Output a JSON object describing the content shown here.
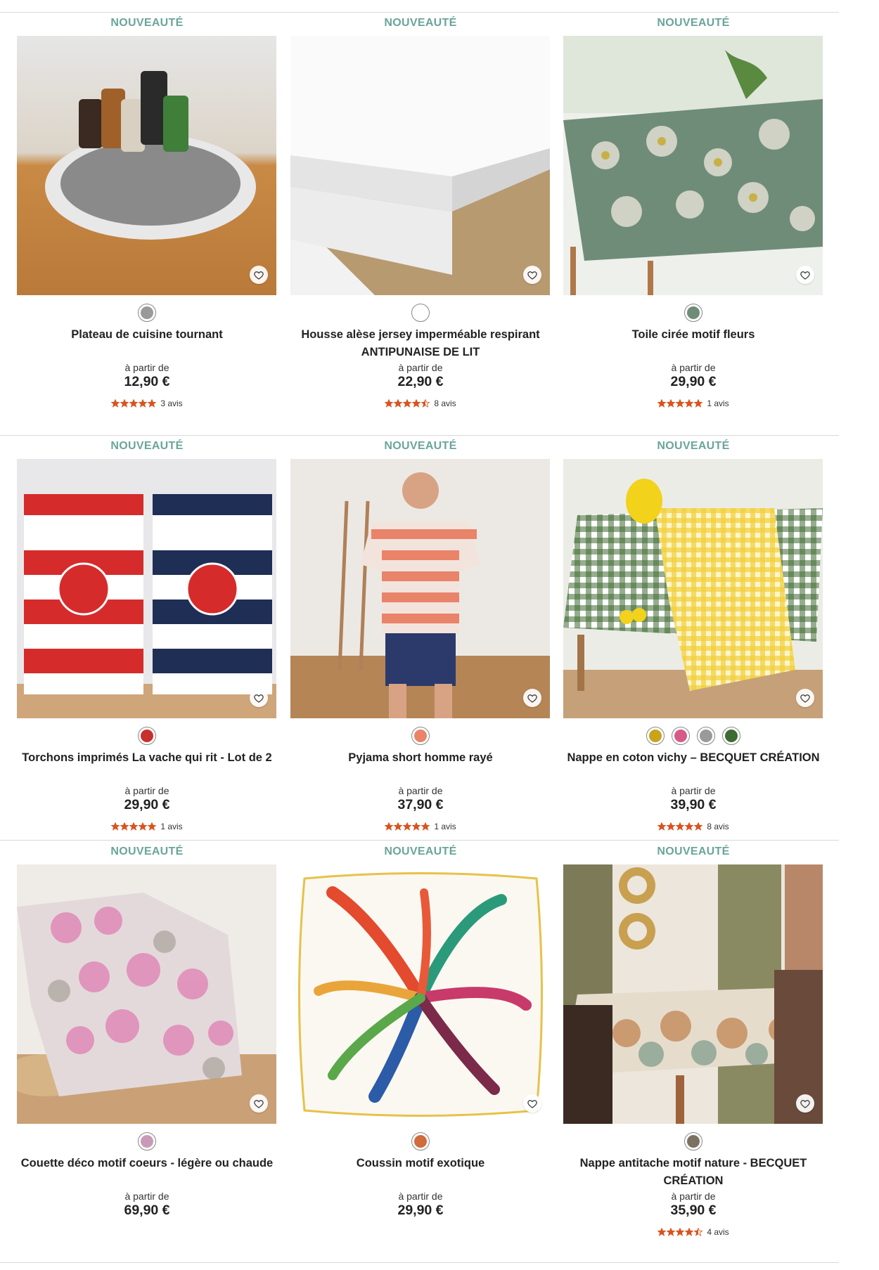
{
  "badge_label": "NOUVEAUTÉ",
  "from_label": "à partir de",
  "colors": {
    "badge": "#6aa59a",
    "star": "#d9531e"
  },
  "products": [
    {
      "badge": "NOUVEAUTÉ",
      "image": "rotating-kitchen-tray-photo",
      "title": "Plateau de cuisine tournant",
      "from": "à partir de",
      "price": "12,90 €",
      "rating": 5,
      "reviews": "3 avis",
      "swatches": [
        "#9a9a9a"
      ]
    },
    {
      "badge": "NOUVEAUTÉ",
      "image": "mattress-protector-photo",
      "title": "Housse alèse jersey imperméable respirant ANTIPUNAISE DE LIT",
      "from": "à partir de",
      "price": "22,90 €",
      "rating": 4.5,
      "reviews": "8 avis",
      "swatches": [
        "#ffffff"
      ]
    },
    {
      "badge": "NOUVEAUTÉ",
      "image": "floral-oilcloth-photo",
      "title": "Toile cirée motif fleurs",
      "from": "à partir de",
      "price": "29,90 €",
      "rating": 5,
      "reviews": "1 avis",
      "swatches": [
        "#6f8c78"
      ]
    },
    {
      "badge": "NOUVEAUTÉ",
      "image": "laughing-cow-tea-towels-photo",
      "title": "Torchons imprimés La vache qui rit - Lot de 2",
      "from": "à partir de",
      "price": "29,90 €",
      "rating": 5,
      "reviews": "1 avis",
      "swatches": [
        "#c8302e"
      ]
    },
    {
      "badge": "NOUVEAUTÉ",
      "image": "striped-pyjama-photo",
      "title": "Pyjama short homme rayé",
      "from": "à partir de",
      "price": "37,90 €",
      "rating": 5,
      "reviews": "1 avis",
      "swatches": [
        "#e9836a"
      ]
    },
    {
      "badge": "NOUVEAUTÉ",
      "image": "gingham-tablecloth-photo",
      "title": "Nappe en coton vichy – BECQUET CRÉATION",
      "from": "à partir de",
      "price": "39,90 €",
      "rating": 5,
      "reviews": "8 avis",
      "swatches": [
        "#c8a41a",
        "#d65a86",
        "#9a9a9a",
        "#3f6b33"
      ]
    },
    {
      "badge": "NOUVEAUTÉ",
      "image": "heart-pattern-duvet-photo",
      "title": "Couette déco motif coeurs - légère ou chaude",
      "from": "à partir de",
      "price": "69,90 €",
      "rating": null,
      "reviews": "",
      "swatches": [
        "#c99ab8"
      ]
    },
    {
      "badge": "NOUVEAUTÉ",
      "image": "exotic-cushion-photo",
      "title": "Coussin motif exotique",
      "from": "à partir de",
      "price": "29,90 €",
      "rating": null,
      "reviews": "",
      "swatches": [
        "#d06b3d"
      ]
    },
    {
      "badge": "NOUVEAUTÉ",
      "image": "nature-tablecloth-photo",
      "title": "Nappe antitache motif nature - BECQUET CRÉATION",
      "from": "à partir de",
      "price": "35,90 €",
      "rating": 4.5,
      "reviews": "4 avis",
      "swatches": [
        "#7d7262"
      ]
    }
  ]
}
